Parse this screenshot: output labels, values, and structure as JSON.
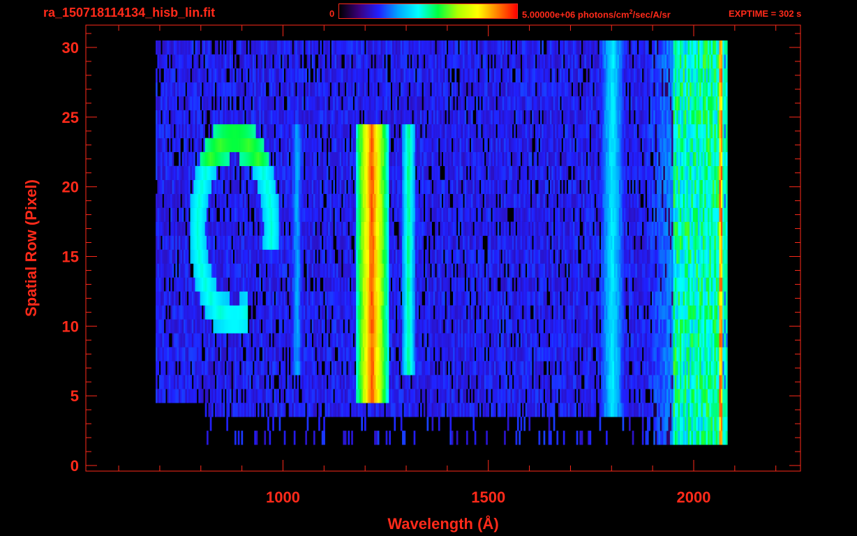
{
  "header": {
    "file_title": "ra_150718114134_hisb_lin.fit",
    "colorbar_min": "0",
    "colorbar_max_value": "5.00000e+06 photons/cm",
    "colorbar_max_sup": "2",
    "colorbar_max_unit_tail": "/sec/A/sr",
    "exptime": "EXPTIME = 302 s"
  },
  "colors": {
    "axis": "#ff2a1a",
    "background": "#000000",
    "colormap": [
      "#000000",
      "#3a007a",
      "#2020ff",
      "#00a8ff",
      "#00ffff",
      "#00ff40",
      "#b0ff00",
      "#ffff00",
      "#ff8000",
      "#ff0000"
    ]
  },
  "chart_data": {
    "type": "heatmap",
    "title": "ra_150718114134_hisb_lin.fit",
    "xlabel": "Wavelength (Å)",
    "ylabel": "Spatial Row (Pixel)",
    "xlim": [
      520,
      2260
    ],
    "ylim": [
      -0.4,
      31.6
    ],
    "x_ticks": [
      1000,
      1500,
      2000
    ],
    "y_ticks": [
      0,
      5,
      10,
      15,
      20,
      25,
      30
    ],
    "x_minor_step": 100,
    "y_minor_step": 1,
    "colorbar": {
      "min": 0,
      "max": 5000000,
      "unit": "photons/cm^2/sec/A/sr"
    },
    "exptime_s": 302,
    "rows": [
      2,
      30
    ],
    "x_range": [
      690,
      2080
    ],
    "features": [
      {
        "name": "arc-ring",
        "x_center": 880,
        "row_center": 17,
        "x_radius": 90,
        "row_radius": 6.5,
        "level": 0.45
      },
      {
        "name": "line",
        "x": 1215,
        "width": 40,
        "rows": [
          5,
          24
        ],
        "level": 0.9
      },
      {
        "name": "line",
        "x": 1304,
        "width": 18,
        "rows": [
          7,
          24
        ],
        "level": 0.5
      },
      {
        "name": "line",
        "x": 1032,
        "width": 16,
        "rows": [
          7,
          24
        ],
        "level": 0.32
      },
      {
        "name": "line",
        "x": 1800,
        "width": 30,
        "rows": [
          3,
          30
        ],
        "level": 0.4
      },
      {
        "name": "band",
        "x": [
          1950,
          2060
        ],
        "rows": [
          2,
          30
        ],
        "level": 0.55
      },
      {
        "name": "edge",
        "x": 2065,
        "rows": [
          2,
          30
        ],
        "level": 0.95
      }
    ],
    "grid": false
  }
}
